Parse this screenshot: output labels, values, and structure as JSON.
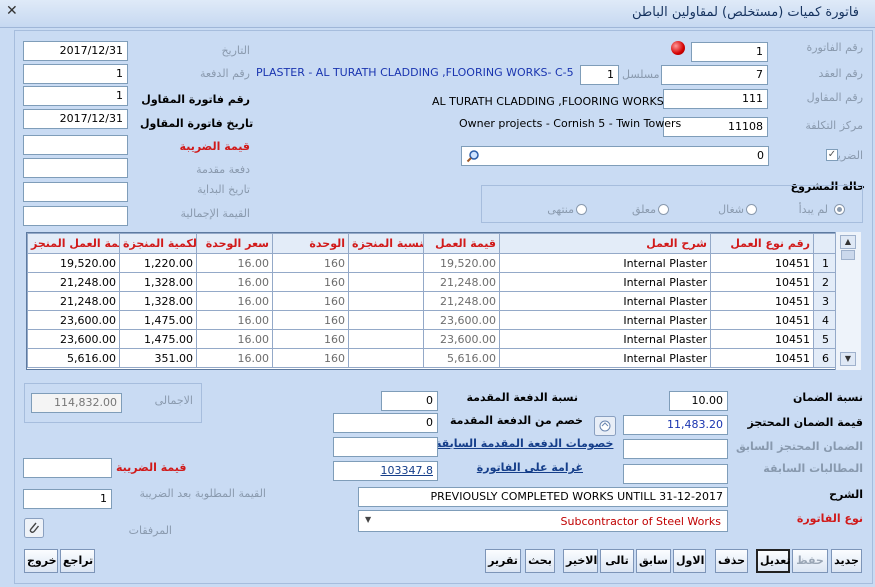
{
  "window": {
    "title": "فاتورة كميات (مستخلص) لمقاولين الباطن",
    "close_glyph": "✕"
  },
  "header": {
    "invoice_no_label": "رقم الفاتورة",
    "invoice_no": "1",
    "contract_no_label": "رقم العقد",
    "contract_no": "7",
    "serial_label": "مسلسل",
    "serial": "1",
    "contract_desc": "PLASTER - AL TURATH CLADDING ,FLOORING WORKS- C-5",
    "contractor_no_label": "رقم المقاول",
    "contractor_no": "111",
    "contractor_name": "AL TURATH CLADDING ,FLOORING WORKS",
    "cost_center_label": "مركز التكلفة",
    "cost_center": "11108",
    "cost_center_name": "Owner projects -  Cornish 5 - Twin Towers",
    "tax_label": "الضريبة",
    "tax_checked": "✓",
    "tax_search_value": "0",
    "date_label": "التاريخ",
    "date": "2017/12/31",
    "payment_no_label": "رقم الدفعة",
    "payment_no": "1",
    "contractor_invoice_no_label": "رقم فاتورة المقاول",
    "contractor_invoice_no": "1",
    "contractor_invoice_date_label": "تاريخ فاتورة المقاول",
    "contractor_invoice_date": "2017/12/31",
    "tax_value_label": "قيمة الضريبة",
    "tax_value": "",
    "advance_payment_label": "دفعة مقدمة",
    "advance_payment": "",
    "start_date_label": "تاريخ البداية",
    "start_date": "",
    "total_value_label": "القيمة الإجمالية",
    "total_value": ""
  },
  "project_status": {
    "label": "حالة المشروع",
    "options": [
      "لم يبدأ",
      "شغال",
      "معلق",
      "منتهى"
    ],
    "selected": "لم يبدأ"
  },
  "grid": {
    "columns": [
      "رقم نوع العمل",
      "شرح العمل",
      "قيمة العمل",
      "النسبة المنجزة",
      "الوحدة",
      "سعر الوحدة",
      "الكمية المنجزة",
      "قيمة العمل المنجز"
    ],
    "rows": [
      {
        "row_no": "1",
        "work_type": "10451",
        "description": "Internal Plaster",
        "work_value": "19,520.00",
        "percent_done": "",
        "unit": "160",
        "unit_price": "16.00",
        "qty_done": "1,220.00",
        "done_value": "19,520.00"
      },
      {
        "row_no": "2",
        "work_type": "10451",
        "description": "Internal Plaster",
        "work_value": "21,248.00",
        "percent_done": "",
        "unit": "160",
        "unit_price": "16.00",
        "qty_done": "1,328.00",
        "done_value": "21,248.00"
      },
      {
        "row_no": "3",
        "work_type": "10451",
        "description": "Internal Plaster",
        "work_value": "21,248.00",
        "percent_done": "",
        "unit": "160",
        "unit_price": "16.00",
        "qty_done": "1,328.00",
        "done_value": "21,248.00"
      },
      {
        "row_no": "4",
        "work_type": "10451",
        "description": "Internal Plaster",
        "work_value": "23,600.00",
        "percent_done": "",
        "unit": "160",
        "unit_price": "16.00",
        "qty_done": "1,475.00",
        "done_value": "23,600.00"
      },
      {
        "row_no": "5",
        "work_type": "10451",
        "description": "Internal Plaster",
        "work_value": "23,600.00",
        "percent_done": "",
        "unit": "160",
        "unit_price": "16.00",
        "qty_done": "1,475.00",
        "done_value": "23,600.00"
      },
      {
        "row_no": "6",
        "work_type": "10451",
        "description": "Internal Plaster",
        "work_value": "5,616.00",
        "percent_done": "",
        "unit": "160",
        "unit_price": "16.00",
        "qty_done": "351.00",
        "done_value": "5,616.00"
      }
    ]
  },
  "footer": {
    "guarantee_pct_label": "نسبة الضمان",
    "guarantee_pct": "10.00",
    "guarantee_held_label": "قيمة الضمان المحتجز",
    "guarantee_held": "11,483.20",
    "prev_guarantee_label": "الضمان المحتجز السابق",
    "prev_guarantee": "",
    "prev_claims_label": "المطالبات السابقة",
    "prev_claims": "",
    "description_label": "الشرح",
    "description": "PREVIOUSLY COMPLETED WORKS UNTILL 31-12-2017",
    "invoice_type_label": "نوع الفاتورة",
    "invoice_type": "Subcontractor of Steel Works",
    "advance_pct_label": "نسبة الدفعة المقدمة",
    "advance_pct": "0",
    "advance_deduct_label": "خصم من الدفعة المقدمة",
    "advance_deduct": "0",
    "prev_advance_deduct_label": "خصومات الدفعة المقدمة السابقة",
    "prev_advance_deduct": "",
    "invoice_penalty_label": "غرامة على الفاتورة",
    "invoice_penalty": "103347.8",
    "grand_total_label": "الاجمالى",
    "grand_total": "114,832.00",
    "tax_value_label": "قيمة الضريبة",
    "tax_value": "",
    "value_after_tax_label": "القيمة المطلوبة بعد الضريبة",
    "value_after_tax": "1",
    "attachments_label": "المرفقات"
  },
  "toolbar": {
    "new": "جديد",
    "save": "حفظ",
    "edit": "تعديل",
    "delete": "حذف",
    "first": "الاول",
    "prev": "سابق",
    "next": "تالى",
    "last": "الاخير",
    "search": "بحث",
    "report": "تقرير",
    "undo": "تراجع",
    "exit": "خروج"
  }
}
